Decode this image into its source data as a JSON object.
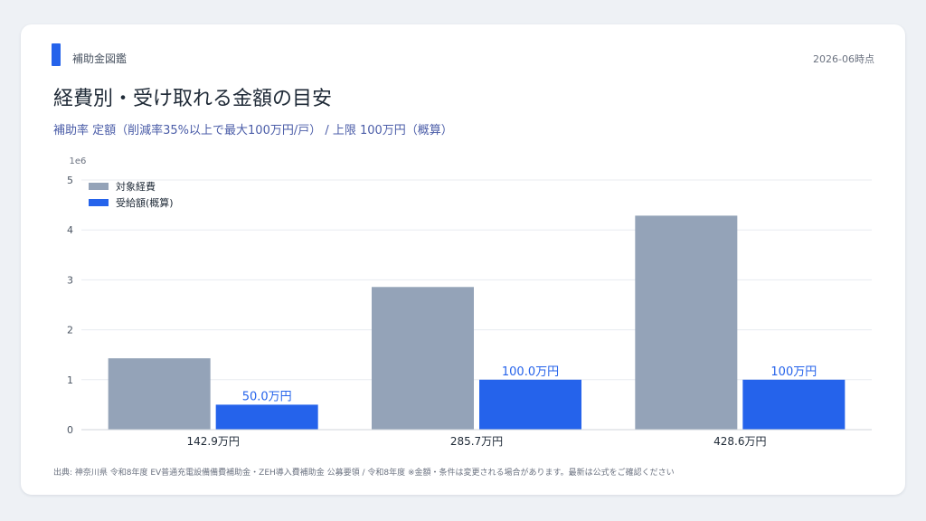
{
  "header": {
    "brand": "補助金図鑑",
    "date": "2026-06時点",
    "title": "経費別・受け取れる金額の目安",
    "subtitle": "補助率 定額（削減率35%以上で最大100万円/戸） / 上限 100万円（概算）"
  },
  "footer": {
    "source": "出典: 神奈川県 令和8年度 EV普通充電設備備費補助金・ZEH導入費補助金 公募要領 / 令和8年度 ※金額・条件は変更される場合があります。最新は公式をご確認ください"
  },
  "colors": {
    "expense": "#94a3b8",
    "subsidy": "#2563eb",
    "label": "#2563eb"
  },
  "chart_data": {
    "type": "bar",
    "categories": [
      "142.9万円",
      "285.7万円",
      "428.6万円"
    ],
    "series": [
      {
        "name": "対象経費",
        "values": [
          1429000,
          2857000,
          4286000
        ]
      },
      {
        "name": "受給額(概算)",
        "values": [
          500000,
          1000000,
          1000000
        ],
        "labels": [
          "50.0万円",
          "100.0万円",
          "100万円"
        ]
      }
    ],
    "y_offset_label": "1e6",
    "yticks": [
      "0",
      "1",
      "2",
      "3",
      "4",
      "5"
    ],
    "ylim": [
      0,
      5000000
    ],
    "grid": true,
    "legend": "top-left"
  }
}
